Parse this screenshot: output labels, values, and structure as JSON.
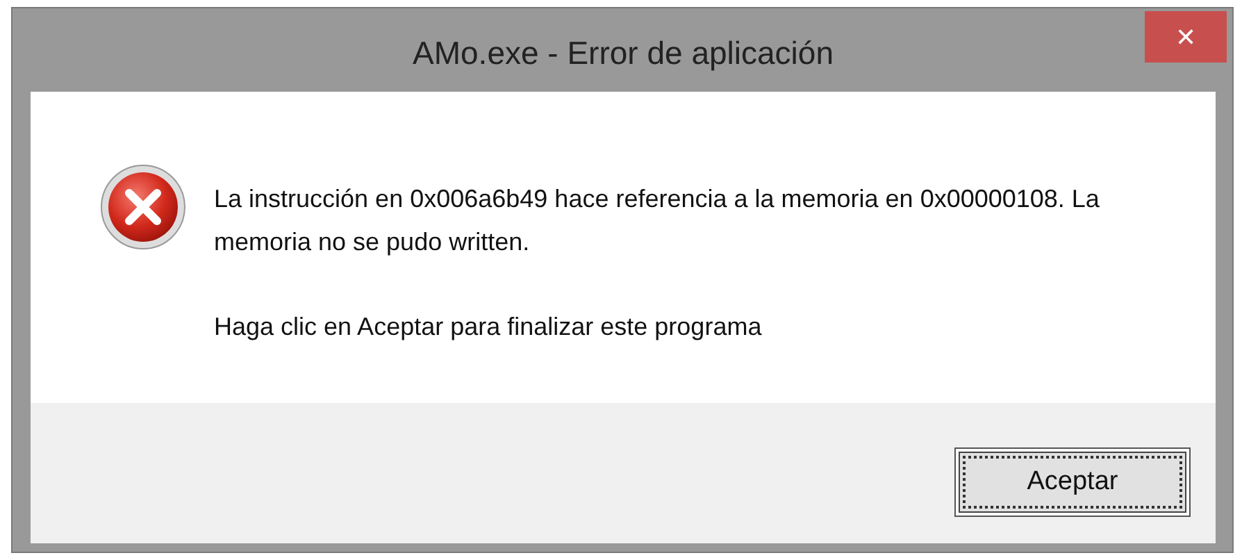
{
  "window": {
    "title": "AMo.exe - Error de aplicación",
    "close": "✕"
  },
  "message": {
    "lines": [
      "La instrucción en 0x006a6b49 hace referencia a la memoria en 0x00000108. La memoria no se pudo written.",
      "Haga clic en Aceptar para finalizar este programa"
    ]
  },
  "buttons": [
    {
      "label": "Aceptar",
      "focused": true
    }
  ]
}
